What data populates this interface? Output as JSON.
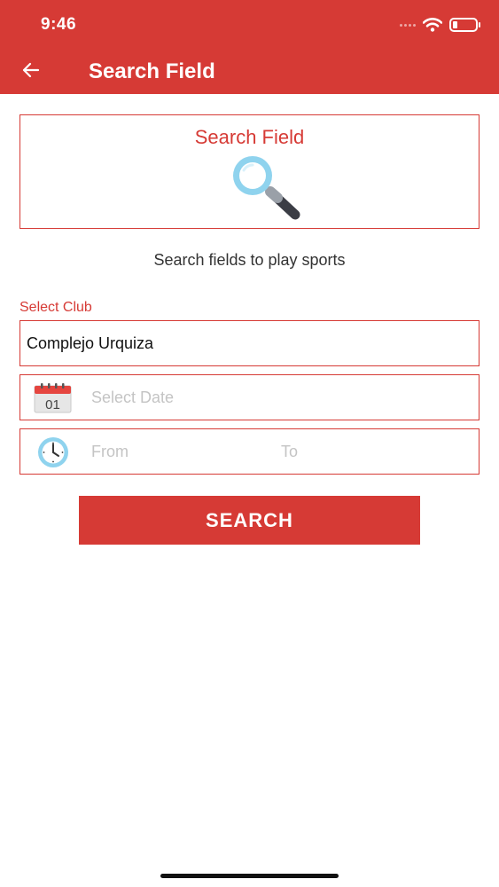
{
  "status_bar": {
    "time": "9:46"
  },
  "header": {
    "title": "Search Field"
  },
  "hero": {
    "title": "Search Field"
  },
  "subtitle": "Search fields to play sports",
  "form": {
    "club_label": "Select Club",
    "club_value": "Complejo Urquiza",
    "date_placeholder": "Select Date",
    "calendar_day": "01",
    "from_placeholder": "From",
    "to_placeholder": "To",
    "search_label": "SEARCH"
  },
  "icons": {
    "back": "arrow-left-icon",
    "hero": "magnifier-icon",
    "date": "calendar-icon",
    "time": "clock-icon"
  },
  "colors": {
    "primary": "#d63a35",
    "placeholder": "#c4c4c4",
    "accent_blue": "#8fd3ee"
  }
}
